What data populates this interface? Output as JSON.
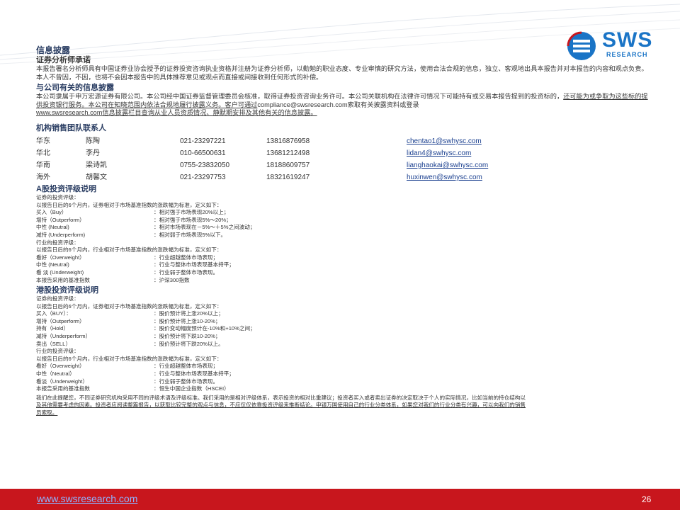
{
  "logo": {
    "name": "SWS",
    "sub": "RESEARCH"
  },
  "colors": {
    "accent": "#c8161d",
    "brand": "#1a74c6",
    "heading": "#2b3e63"
  },
  "disclosure": {
    "title": "信息披露",
    "subtitle": "证券分析师承诺",
    "p1": "本报告署名分析师具有中国证券业协会授予的证券投资咨询执业资格并注册为证券分析师，以勤勉的职业态度、专业审慎的研究方法，使用合法合规的信息，独立、客观地出具本报告并对本报告的内容和观点负责。本人不曾因，不因，也将不会因本报告中的具体推荐意见或观点而直接或间接收到任何形式的补偿。",
    "related_title": "与公司有关的信息披露",
    "p2a": "本公司隶属于申万宏源证券有限公司。本公司经中国证券监督管理委员会核准，取得证券投资咨询业务许可。本公司关联机构在法律许可情况下可能持有或交易本报告提到的投资标的，",
    "p2b": "还可能为或争取为这些标的提供投资银行服务。本公司在知晓范围内依法合规地履行披露义务。客户可通过",
    "p2c": "compliance@swsresearch.com索取有关披露资料或登录",
    "p2d": "www.swsresearch.com信息披露栏目查询从业人员资质情况、静默期安排及其他有关的信息披露。"
  },
  "contacts": {
    "title": "机构销售团队联系人",
    "rows": [
      {
        "region": "华东",
        "name": "陈陶",
        "phone": "021-23297221",
        "mobile": "13816876958",
        "email": "chentao1@swhysc.com"
      },
      {
        "region": "华北",
        "name": "李丹",
        "phone": "010-66500631",
        "mobile": "13681212498",
        "email": "lidan4@swhysc.com"
      },
      {
        "region": "华南",
        "name": "梁诗凯",
        "phone": "0755-23832050",
        "mobile": "18188609757",
        "email": "lianghaokai@swhysc.com"
      },
      {
        "region": "海外",
        "name": "胡馨文",
        "phone": "021-23297753",
        "mobile": "18321619247",
        "email": "huxinwen@swhysc.com"
      }
    ]
  },
  "a_share": {
    "title": "A股投资评级说明",
    "stock_label": "证券的投资评级：",
    "stock_desc": "以报告日后的6个月内，证券相对于市场基准指数的涨跌幅为标准，定义如下：",
    "stock_ratings": [
      {
        "k": "买入（Buy）",
        "v": "：相对强于市场表现20%以上；"
      },
      {
        "k": "增持（Outperform）",
        "v": "：相对强于市场表现5%～20%；"
      },
      {
        "k": "中性 (Neutral)",
        "v": "：相对市场表现在－5%～＋5%之间波动；"
      },
      {
        "k": "减持 (Underperform)",
        "v": "：相对弱于市场表现5%以下。"
      }
    ],
    "industry_label": "行业的投资评级：",
    "industry_desc": "以报告日后的6个月内，行业相对于市场基准指数的涨跌幅为标准，定义如下：",
    "industry_ratings": [
      {
        "k": "看好（Overweight）",
        "v": "：行业超越整体市场表现；"
      },
      {
        "k": "中性 (Neutral)",
        "v": "：行业与整体市场表现基本持平；"
      },
      {
        "k": "看 淡 (Underweight)",
        "v": "：行业弱于整体市场表现。"
      },
      {
        "k": "本报告采用的基准指数",
        "v": "：沪深300指数"
      }
    ]
  },
  "hk_share": {
    "title": "港股投资评级说明",
    "stock_label": "证券的投资评级：",
    "stock_desc": "以报告日后的6个月内，证券相对于市场基准指数的涨跌幅为标准，定义如下：",
    "stock_ratings": [
      {
        "k": "买入（BUY）：",
        "v": "：股价预计将上涨20%以上；"
      },
      {
        "k": "增持（Outperform）",
        "v": "：股价预计将上涨10-20%；"
      },
      {
        "k": "持有（Hold）",
        "v": "：股价变动幅度预计在-10%和+10%之间；"
      },
      {
        "k": "减持（Underperform）",
        "v": "：股价预计将下跌10-20%；"
      },
      {
        "k": "卖出（SELL）",
        "v": "：股价预计将下跌20%以上。"
      }
    ],
    "industry_label": "行业的投资评级：",
    "industry_desc": "以报告日后的6个月内，行业相对于市场基准指数的涨跌幅为标准，定义如下：",
    "industry_ratings": [
      {
        "k": "看好（Overweight）",
        "v": "：行业超越整体市场表现；"
      },
      {
        "k": "中性（Neutral）",
        "v": "：行业与整体市场表现基本持平；"
      },
      {
        "k": "看淡（Underweight）",
        "v": "：行业弱于整体市场表现。"
      },
      {
        "k": "本报告采用的基准指数",
        "v": "：恒生中国企业指数（HSCEI）"
      }
    ]
  },
  "bottom_note": {
    "line1": "我们在此提醒您，不同证券研究机构采用不同的评级术语及评级标准。我们采用的是相对评级体系，表示投资的相对比重建议；投资者买入或者卖出证券的决定取决于个人的实际情况，比如当前的持仓结构以",
    "line2": "及其他需要考虑的因素。投资者应阅读整篇报告，以获取比较完整的观点与信息，不应仅仅依靠投资评级来推断结论。申银万国使用自己的行业分类体系，如果您对我们的行业分类有兴趣，可以向我们的销售",
    "line3": "员索取。"
  },
  "footer": {
    "url": "www.swsresearch.com",
    "page": "26"
  }
}
